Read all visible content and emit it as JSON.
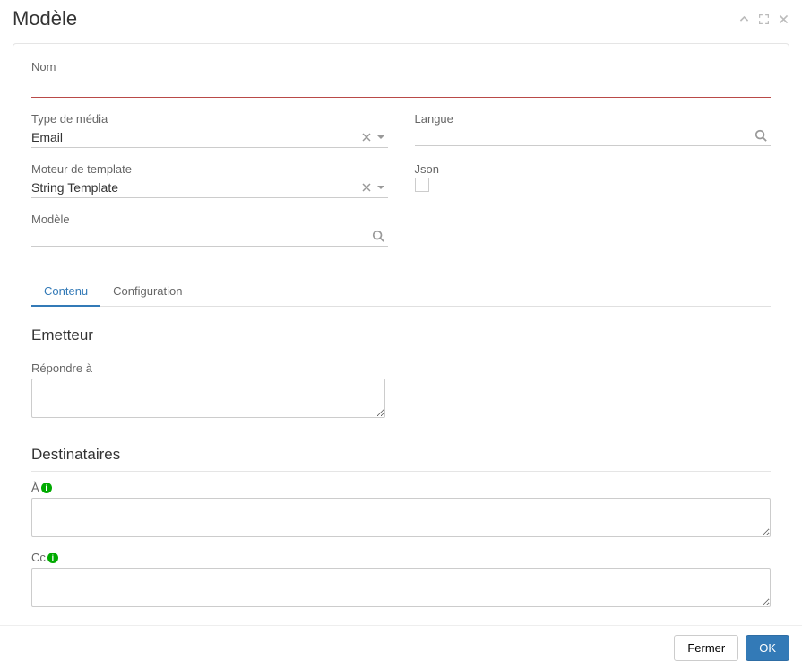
{
  "header": {
    "title": "Modèle"
  },
  "form": {
    "name_label": "Nom",
    "media_type_label": "Type de média",
    "media_type_val": "Email",
    "lang_label": "Langue",
    "engine_label": "Moteur de template",
    "engine_val": "String Template",
    "json_label": "Json",
    "model_label": "Modèle"
  },
  "tabs": {
    "content": "Contenu",
    "config": "Configuration"
  },
  "sections": {
    "emitter_title": "Emetteur",
    "reply_to_label": "Répondre à",
    "recipients_title": "Destinataires",
    "to_label": "À",
    "cc_label": "Cc"
  },
  "footer": {
    "close": "Fermer",
    "ok": "OK"
  }
}
